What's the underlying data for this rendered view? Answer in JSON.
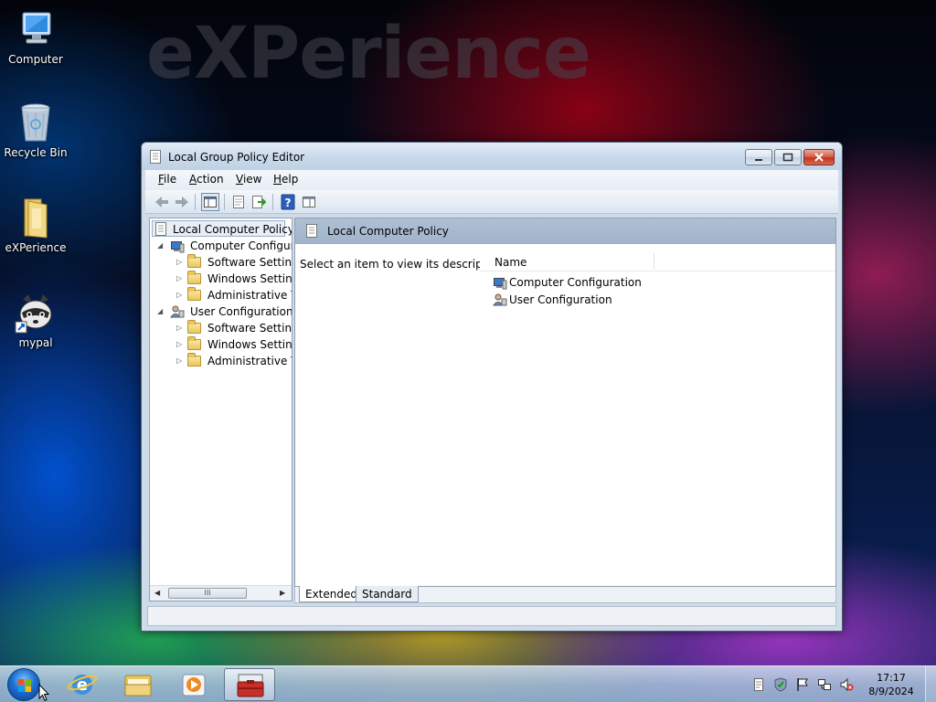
{
  "desktop": {
    "watermark": "eXPerience",
    "icons": [
      {
        "label": "Computer",
        "icon": "computer-icon"
      },
      {
        "label": "Recycle Bin",
        "icon": "recycle-bin-icon"
      },
      {
        "label": "eXPerience",
        "icon": "folder-icon"
      },
      {
        "label": "mypal",
        "icon": "mypal-raccoon-icon"
      }
    ]
  },
  "window": {
    "title": "Local Group Policy Editor",
    "menu": [
      {
        "label": "File",
        "accel": "F",
        "rest": "ile"
      },
      {
        "label": "Action",
        "accel": "A",
        "rest": "ction"
      },
      {
        "label": "View",
        "accel": "V",
        "rest": "iew"
      },
      {
        "label": "Help",
        "accel": "H",
        "rest": "elp"
      }
    ],
    "toolbar_icons": [
      "back-arrow-icon",
      "forward-arrow-icon",
      "show-hide-tree-icon",
      "properties-icon",
      "export-list-icon",
      "help-icon",
      "show-action-pane-icon"
    ],
    "tree": {
      "root": "Local Computer Policy",
      "items": [
        {
          "label": "Computer Configura",
          "level": 1,
          "expanded": true
        },
        {
          "label": "Software Settings",
          "level": 2
        },
        {
          "label": "Windows Setting",
          "level": 2
        },
        {
          "label": "Administrative Te",
          "level": 2
        },
        {
          "label": "User Configuration",
          "level": 1,
          "expanded": true
        },
        {
          "label": "Software Settings",
          "level": 2
        },
        {
          "label": "Windows Setting",
          "level": 2
        },
        {
          "label": "Administrative Te",
          "level": 2
        }
      ],
      "scroll_glyph": "III"
    },
    "result": {
      "header": "Local Computer Policy",
      "description": "Select an item to view its description.",
      "column_name": "Name",
      "rows": [
        {
          "label": "Computer Configuration",
          "icon": "computer-config-icon"
        },
        {
          "label": "User Configuration",
          "icon": "user-config-icon"
        }
      ]
    },
    "tabs": [
      {
        "label": "Extended",
        "active": true
      },
      {
        "label": "Standard",
        "active": false
      }
    ]
  },
  "taskbar": {
    "pinned": [
      "start-orb-icon",
      "internet-explorer-icon",
      "windows-explorer-icon",
      "media-player-icon",
      "group-policy-editor-icon"
    ],
    "tray": [
      "notes-icon",
      "security-icon",
      "action-center-flag-icon",
      "network-icon",
      "volume-muted-icon"
    ],
    "time": "17:17",
    "date": "8/9/2024"
  }
}
